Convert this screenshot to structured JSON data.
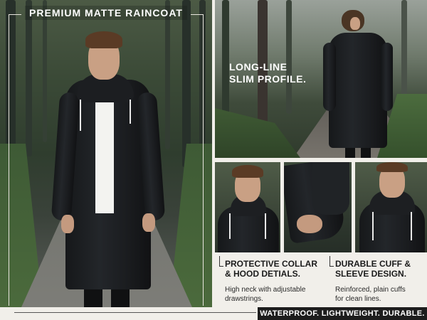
{
  "hero": {
    "title": "PREMIUM MATTE RAINCOAT"
  },
  "feature_top": {
    "line1": "LONG-LINE",
    "line2": "SLIM PROFILE."
  },
  "detail_collar": {
    "heading_line1": "PROTECTIVE COLLAR",
    "heading_line2": "& HOOD DETIALS.",
    "body_line1": "High neck with adjustable",
    "body_line2": "drawstrings."
  },
  "detail_cuff": {
    "heading_line1": "DURABLE CUFF &",
    "heading_line2": "SLEEVE DESIGN.",
    "body_line1": "Reinforced, plain cuffs",
    "body_line2": "for clean lines."
  },
  "tagline": "WATERPROOF. LIGHTWEIGHT. DURABLE.",
  "colors": {
    "coat": "#1b1d20",
    "background": "#f1efea",
    "tagline_bg": "#1d1d1d"
  }
}
